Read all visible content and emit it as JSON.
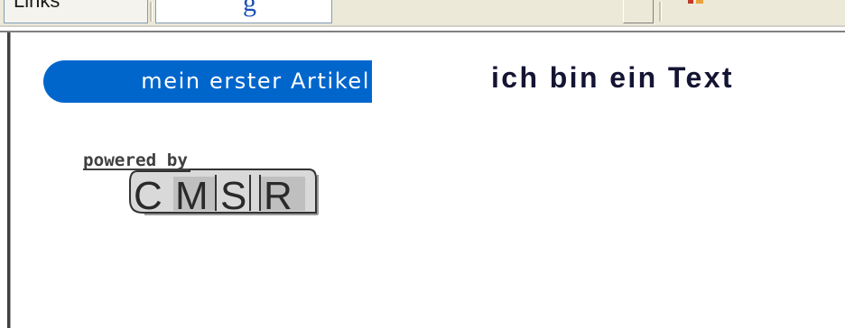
{
  "toolbar": {
    "left_field_text": "Links",
    "search_logo_letter": "g"
  },
  "content": {
    "article_tab_label": "mein erster Artikel",
    "body_text": "ich bin ein Text"
  },
  "footer_logo": {
    "powered_by": "powered by",
    "brand_letters": [
      "C",
      "M",
      "S",
      "R"
    ]
  },
  "colors": {
    "tab_background": "#0066cc",
    "tab_text": "#ffffff",
    "body_text": "#141433"
  }
}
